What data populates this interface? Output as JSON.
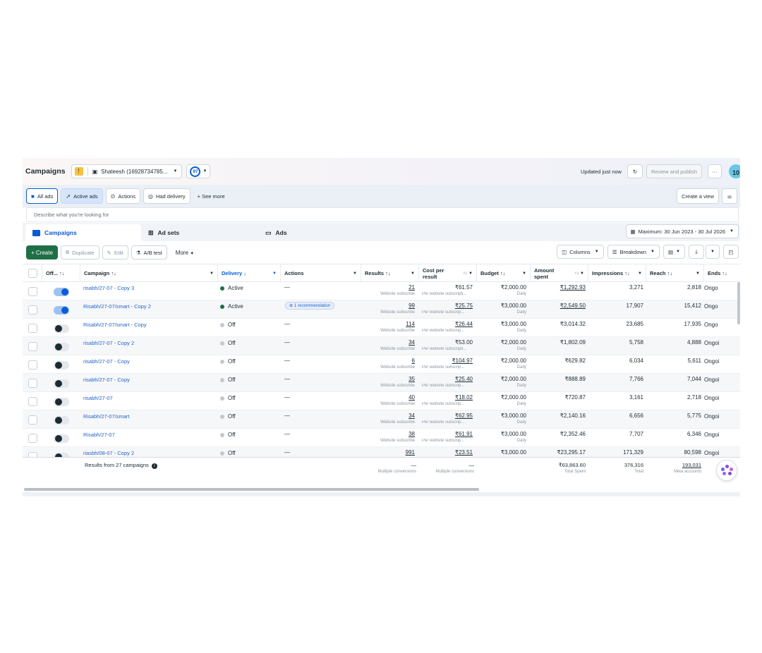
{
  "header": {
    "title": "Campaigns",
    "warning_badge": "!",
    "account_name": "Shateesh (16928734785...",
    "score": "97",
    "updated": "Updated just now",
    "review_publish": "Review and publish",
    "more_menu": "···",
    "avatar_text": "10"
  },
  "filters": {
    "all_ads": "All ads",
    "active_ads": "Active ads",
    "actions": "Actions",
    "had_delivery": "Had delivery",
    "see_more": "+ See more",
    "create_view": "Create a view"
  },
  "search": {
    "placeholder": "Describe what you're looking for"
  },
  "tabs": {
    "campaigns": "Campaigns",
    "ad_sets": "Ad sets",
    "ads": "Ads",
    "date_range": "Maximum: 30 Jun 2023 - 30 Jul 2026"
  },
  "toolbar": {
    "create": "+ Create",
    "duplicate": "Duplicate",
    "edit": "Edit",
    "ab_test": "A/B test",
    "more": "More",
    "columns": "Columns",
    "breakdown": "Breakdown"
  },
  "columns": {
    "off_on": "Off... ↑↓",
    "campaign": "Campaign ↑↓",
    "delivery": "Delivery ↓",
    "actions": "Actions",
    "results": "Results ↑↓",
    "cost_per_result": "Cost per result",
    "budget": "Budget ↑↓",
    "amount_spent": "Amount spent",
    "impressions": "Impressions ↑↓",
    "reach": "Reach ↑↓",
    "ends": "Ends ↑↓"
  },
  "rows": [
    {
      "on": true,
      "campaign": "risabh/27-07 - Copy 3",
      "delivery": "Active",
      "action": "—",
      "results": "21",
      "results_sub": "Website subscribe",
      "cost": "₹61.57",
      "cost_sub": "Per website subscripti...",
      "cost_u": false,
      "budget": "₹2,000.00",
      "budget_sub": "Daily",
      "spent": "₹1,292.93",
      "spent_u": true,
      "impressions": "3,271",
      "reach": "2,818",
      "ends": "Ongo"
    },
    {
      "on": true,
      "campaign": "Risabh/27-07/smart - Copy 2",
      "delivery": "Active",
      "action": "1 recommendation",
      "results": "99",
      "results_sub": "Website subscribe",
      "cost": "₹25.75",
      "cost_sub": "Per website subscrip...",
      "cost_u": true,
      "budget": "₹3,000.00",
      "budget_sub": "Daily",
      "spent": "₹2,549.50",
      "spent_u": true,
      "impressions": "17,907",
      "reach": "15,412",
      "ends": "Ongo"
    },
    {
      "on": false,
      "campaign": "Risabh/27-07/smart - Copy",
      "delivery": "Off",
      "action": "—",
      "results": "114",
      "results_sub": "Website subscribe",
      "cost": "₹26.44",
      "cost_sub": "Per website subscrip...",
      "cost_u": true,
      "budget": "₹3,000.00",
      "budget_sub": "Daily",
      "spent": "₹3,014.32",
      "spent_u": false,
      "impressions": "23,685",
      "reach": "17,935",
      "ends": "Ongo"
    },
    {
      "on": false,
      "campaign": "risabh/27-07 - Copy 2",
      "delivery": "Off",
      "action": "—",
      "results": "34",
      "results_sub": "Website subscribe",
      "cost": "₹53.00",
      "cost_sub": "Per website subscripti...",
      "cost_u": false,
      "budget": "₹2,000.00",
      "budget_sub": "Daily",
      "spent": "₹1,802.09",
      "spent_u": false,
      "impressions": "5,758",
      "reach": "4,888",
      "ends": "Ongoi"
    },
    {
      "on": false,
      "campaign": "risabh/27-07 - Copy",
      "delivery": "Off",
      "action": "—",
      "results": "6",
      "results_sub": "Website subscribe",
      "cost": "₹104.97",
      "cost_sub": "Per website subscrip...",
      "cost_u": true,
      "budget": "₹2,000.00",
      "budget_sub": "Daily",
      "spent": "₹629.82",
      "spent_u": false,
      "impressions": "6,034",
      "reach": "5,611",
      "ends": "Ongoi"
    },
    {
      "on": false,
      "campaign": "risabh/27-07 - Copy",
      "delivery": "Off",
      "action": "—",
      "results": "35",
      "results_sub": "Website subscribe",
      "cost": "₹25.40",
      "cost_sub": "Per website subscrip...",
      "cost_u": true,
      "budget": "₹2,000.00",
      "budget_sub": "Daily",
      "spent": "₹888.89",
      "spent_u": false,
      "impressions": "7,766",
      "reach": "7,044",
      "ends": "Ongoi"
    },
    {
      "on": false,
      "campaign": "risabh/27-07",
      "delivery": "Off",
      "action": "—",
      "results": "40",
      "results_sub": "Website subscribe",
      "cost": "₹18.02",
      "cost_sub": "Per website subscrip...",
      "cost_u": true,
      "budget": "₹2,000.00",
      "budget_sub": "Daily",
      "spent": "₹720.87",
      "spent_u": false,
      "impressions": "3,161",
      "reach": "2,718",
      "ends": "Ongoi"
    },
    {
      "on": false,
      "campaign": "Risabh/27-07/smart",
      "delivery": "Off",
      "action": "—",
      "results": "34",
      "results_sub": "Website subscribe",
      "cost": "₹62.95",
      "cost_sub": "Per website subscrip...",
      "cost_u": true,
      "budget": "₹3,000.00",
      "budget_sub": "Daily",
      "spent": "₹2,140.16",
      "spent_u": false,
      "impressions": "6,656",
      "reach": "5,775",
      "ends": "Ongoi"
    },
    {
      "on": false,
      "campaign": "Risabh/27-07",
      "delivery": "Off",
      "action": "—",
      "results": "38",
      "results_sub": "Website subscribe",
      "cost": "₹61.91",
      "cost_sub": "Per website subscrip...",
      "cost_u": true,
      "budget": "₹3,000.00",
      "budget_sub": "Daily",
      "spent": "₹2,352.46",
      "spent_u": false,
      "impressions": "7,707",
      "reach": "6,346",
      "ends": "Ongoi"
    },
    {
      "on": false,
      "campaign": "riasbh/08-07 - Copy 2",
      "delivery": "Off",
      "action": "—",
      "results": "991",
      "results_sub": "",
      "cost": "₹23.51",
      "cost_sub": "",
      "cost_u": true,
      "budget": "₹3,000.00",
      "budget_sub": "",
      "spent": "₹23,295.17",
      "spent_u": false,
      "impressions": "171,329",
      "reach": "80,598",
      "ends": "Ongoi"
    }
  ],
  "totals": {
    "label": "Results from 27 campaigns",
    "results": "—",
    "results_sub": "Multiple conversions",
    "cost": "—",
    "cost_sub": "Multiple conversions",
    "spent": "₹63,863.60",
    "spent_sub": "Total Spent",
    "impressions": "376,316",
    "impressions_sub": "Total",
    "reach": "193,031",
    "reach_sub": "Meta accounts"
  }
}
